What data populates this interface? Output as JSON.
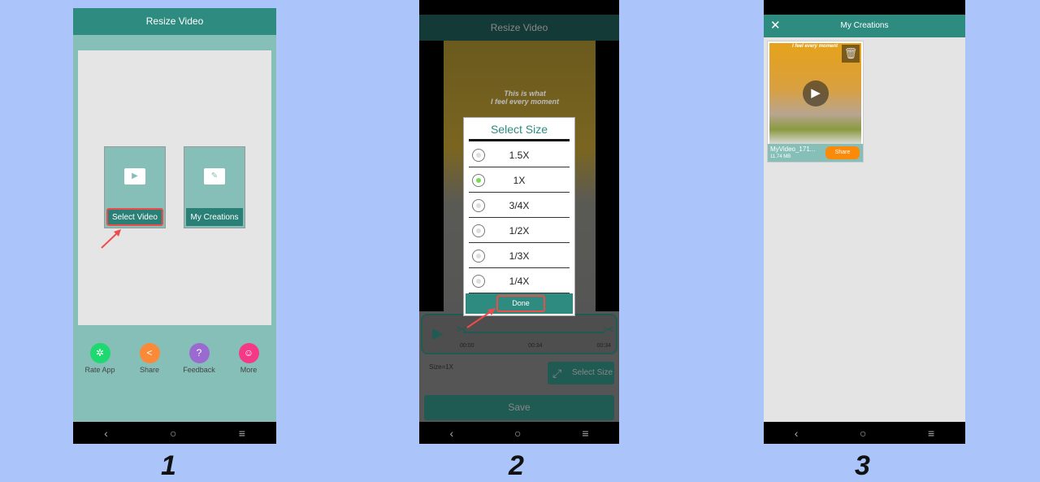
{
  "screen1": {
    "title": "Resize Video",
    "tiles": [
      {
        "label": "Select Video",
        "icon": "film-play-icon"
      },
      {
        "label": "My Creations",
        "icon": "film-edit-icon"
      }
    ],
    "bottom": [
      {
        "label": "Rate App",
        "color": "#1ed96f",
        "icon": "stars-icon"
      },
      {
        "label": "Share",
        "color": "#fb8a38",
        "icon": "share-icon"
      },
      {
        "label": "Feedback",
        "color": "#9a6ad0",
        "icon": "question-icon"
      },
      {
        "label": "More",
        "color": "#f43a86",
        "icon": "smile-icon"
      }
    ]
  },
  "screen2": {
    "title": "Resize Video",
    "overlay_text": "This is what\nI feel every moment",
    "dialog": {
      "title": "Select Size",
      "options": [
        "1.5X",
        "1X",
        "3/4X",
        "1/2X",
        "1/3X",
        "1/4X"
      ],
      "selected": "1X",
      "done": "Done"
    },
    "trim": {
      "start": "00:00",
      "mid": "00:34",
      "end": "00:34"
    },
    "size_label": "Size=1X",
    "select_size": "Select Size",
    "save": "Save"
  },
  "screen3": {
    "title": "My Creations",
    "video": {
      "name": "MyVideo_171...",
      "size": "11.74 MB",
      "overlay_text": "I feel every moment",
      "share": "Share"
    }
  },
  "steps": [
    "1",
    "2",
    "3"
  ],
  "colors": {
    "teal": "#2e8b80",
    "accent_red": "#f04b4b",
    "background": "#abc5fb"
  }
}
